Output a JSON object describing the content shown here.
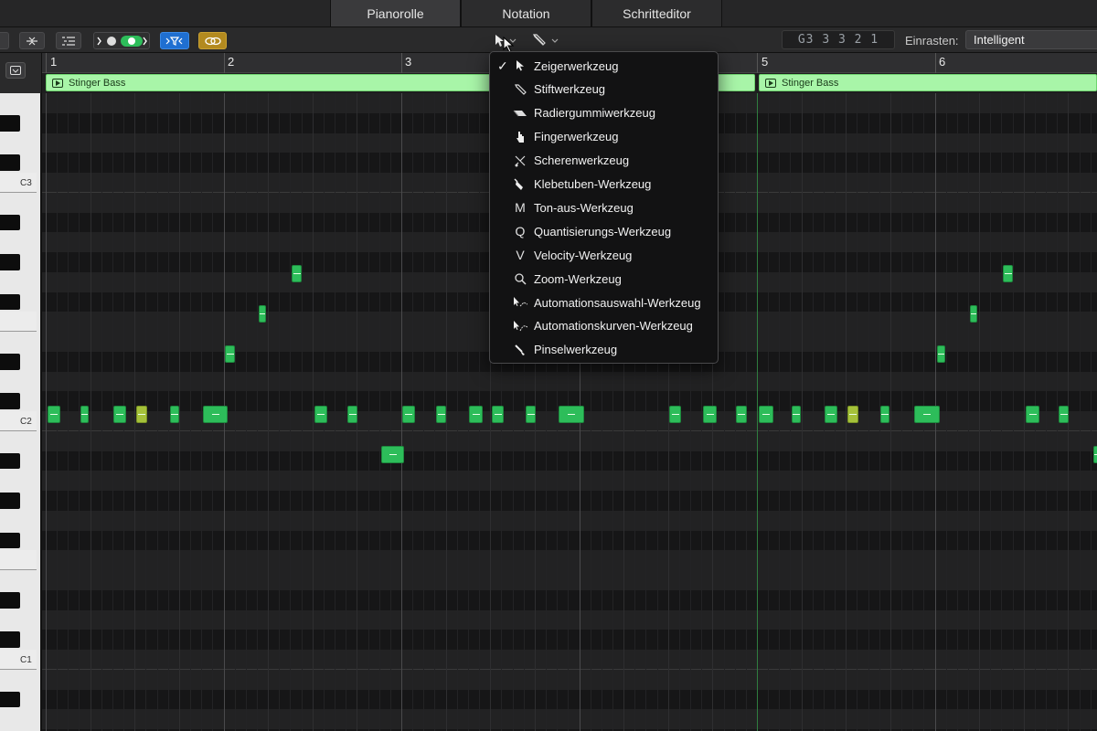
{
  "tabs": [
    {
      "label": "Pianorolle",
      "active": true
    },
    {
      "label": "Notation",
      "active": false
    },
    {
      "label": "Schritteditor",
      "active": false
    }
  ],
  "toolbar": {
    "lcd_position": "G3   3 3 2 1",
    "snap_label": "Einrasten:",
    "snap_value": "Intelligent"
  },
  "ruler": {
    "bars": [
      "1",
      "2",
      "3",
      "5",
      "6"
    ]
  },
  "regions": [
    {
      "name": "Stinger Bass"
    },
    {
      "name": "Stinger Bass"
    }
  ],
  "keyboard": {
    "labels": [
      "C3",
      "C2",
      "C1"
    ]
  },
  "tool_menu": {
    "items": [
      {
        "label": "Zeigerwerkzeug",
        "icon": "pointer-icon",
        "checked": true
      },
      {
        "label": "Stiftwerkzeug",
        "icon": "pencil-icon",
        "checked": false
      },
      {
        "label": "Radiergummiwerkzeug",
        "icon": "eraser-icon",
        "checked": false
      },
      {
        "label": "Fingerwerkzeug",
        "icon": "finger-icon",
        "checked": false
      },
      {
        "label": "Scherenwerkzeug",
        "icon": "scissors-icon",
        "checked": false
      },
      {
        "label": "Klebetuben-Werkzeug",
        "icon": "glue-icon",
        "checked": false
      },
      {
        "label": "Ton-aus-Werkzeug",
        "icon": "mute-icon",
        "glyph": "M",
        "checked": false
      },
      {
        "label": "Quantisierungs-Werkzeug",
        "icon": "quantize-icon",
        "glyph": "Q",
        "checked": false
      },
      {
        "label": "Velocity-Werkzeug",
        "icon": "velocity-icon",
        "glyph": "V",
        "checked": false
      },
      {
        "label": "Zoom-Werkzeug",
        "icon": "zoom-icon",
        "checked": false
      },
      {
        "label": "Automationsauswahl-Werkzeug",
        "icon": "automation-select-icon",
        "checked": false
      },
      {
        "label": "Automationskurven-Werkzeug",
        "icon": "automation-curve-icon",
        "checked": false
      },
      {
        "label": "Pinselwerkzeug",
        "icon": "brush-icon",
        "checked": false
      }
    ]
  },
  "colors": {
    "note": "#2dbd5a",
    "note_selected": "#a5c13a",
    "region": "#a8f5a8",
    "blue_button": "#1f6fd1",
    "gold_button": "#b38a1f"
  }
}
